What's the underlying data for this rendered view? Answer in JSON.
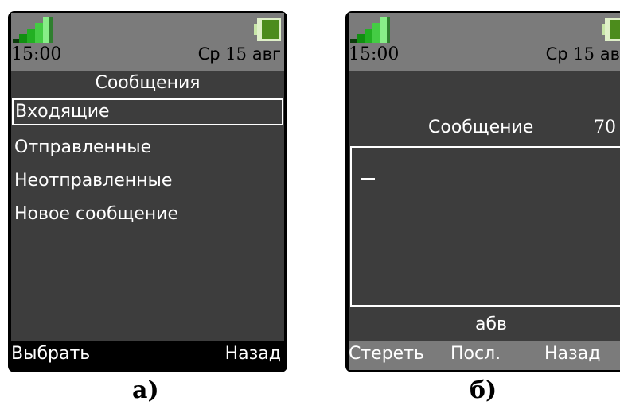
{
  "phones": [
    {
      "status": {
        "time": "15:00",
        "day": "Ср",
        "day_num": "15",
        "month": "авг"
      },
      "title": "Сообщения",
      "menu": [
        {
          "label": "Входящие",
          "selected": true
        },
        {
          "label": "Отправленные",
          "selected": false
        },
        {
          "label": "Неотправленные",
          "selected": false
        },
        {
          "label": "Новое сообщение",
          "selected": false
        }
      ],
      "softkeys": {
        "left": "Выбрать",
        "right": "Назад"
      },
      "caption": "а)"
    },
    {
      "status": {
        "time": "15:00",
        "day": "Ср",
        "day_num": "15",
        "month": "авг"
      },
      "message_title": "Сообщение",
      "char_count": "70",
      "input_mode": "абв",
      "softkeys": {
        "left": "Стереть",
        "middle": "Посл.",
        "right": "Назад"
      },
      "caption": "б)"
    }
  ],
  "colors": {
    "status_bg": "#7b7b7b",
    "screen_bg": "#3d3d3d",
    "signal_green": "#3cc43c",
    "battery_green": "#4c8c1c"
  },
  "icons": {
    "signal": "signal-strength-icon",
    "battery": "battery-icon"
  }
}
